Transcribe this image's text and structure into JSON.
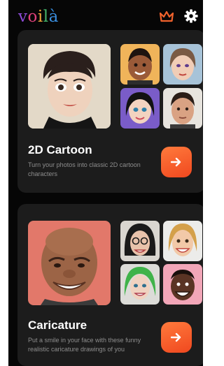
{
  "header": {
    "logo_letters": [
      "v",
      "o",
      "i",
      "l",
      "à"
    ],
    "logo_colors": [
      "#8e4bd6",
      "#e0417a",
      "#f0a63a",
      "#44b36a",
      "#3a8fe0"
    ],
    "crown_icon": "crown-icon",
    "settings_icon": "gear-icon"
  },
  "cards": [
    {
      "title": "2D Cartoon",
      "description": "Turn your photos into classic 2D cartoon characters",
      "action_icon": "arrow-right-icon"
    },
    {
      "title": "Caricature",
      "description": "Put a smile in your face with these funny realistic caricature drawings of you",
      "action_icon": "arrow-right-icon"
    }
  ],
  "colors": {
    "background": "#060606",
    "card": "#1c1c1c",
    "accent": "#f25a26",
    "description_text": "#8e8e8e"
  }
}
